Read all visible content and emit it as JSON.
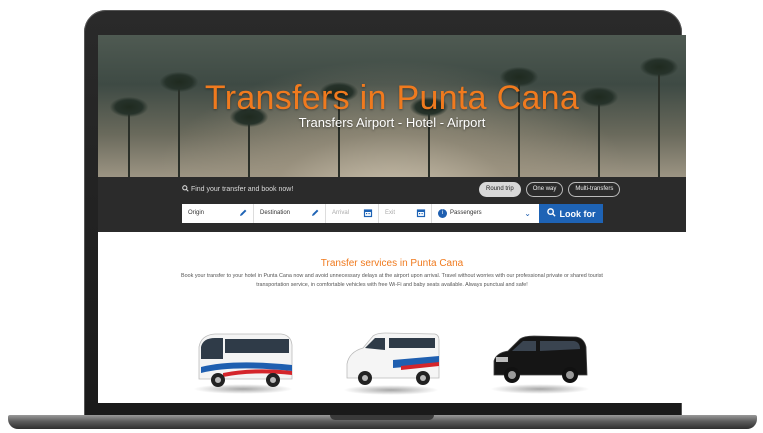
{
  "hero": {
    "title": "Transfers in Punta Cana",
    "subtitle": "Transfers Airport - Hotel - Airport"
  },
  "booking": {
    "find_label": "Find your transfer and book now!",
    "trip_types": [
      {
        "label": "Round trip",
        "active": true
      },
      {
        "label": "One way",
        "active": false
      },
      {
        "label": "Multi-transfers",
        "active": false
      }
    ],
    "fields": {
      "origin": "Origin",
      "destination": "Destination",
      "arrival": "Arrival",
      "exit": "Exit",
      "passengers": "Passengers"
    },
    "search_button": "Look for"
  },
  "content": {
    "title": "Transfer services in Punta Cana",
    "description": "Book your transfer to your hotel in Punta Cana now and avoid unnecessary delays at the airport upon arrival. Travel without worries with our professional private or shared tourist transportation service, in comfortable vehicles with free Wi-Fi and baby seats available. Always punctual and safe!"
  },
  "colors": {
    "accent": "#f07a1e",
    "primary": "#1e63b5",
    "bar": "#2b2b2b"
  }
}
